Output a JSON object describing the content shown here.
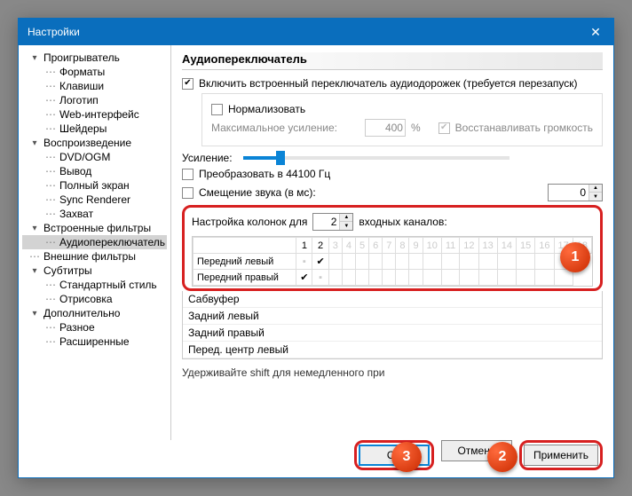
{
  "window": {
    "title": "Настройки"
  },
  "tree": {
    "player": "Проигрыватель",
    "formats": "Форматы",
    "keys": "Клавиши",
    "logo": "Логотип",
    "webui": "Web-интерфейс",
    "shaders": "Шейдеры",
    "playback": "Воспроизведение",
    "dvdogm": "DVD/OGM",
    "output": "Вывод",
    "fullscreen": "Полный экран",
    "syncrender": "Sync Renderer",
    "capture": "Захват",
    "intfilters": "Встроенные фильтры",
    "audioswitch": "Аудиопереключатель",
    "extfilters": "Внешние фильтры",
    "subtitles": "Субтитры",
    "stdstyle": "Стандартный стиль",
    "rendering": "Отрисовка",
    "advanced": "Дополнительно",
    "misc": "Разное",
    "extended": "Расширенные"
  },
  "panel": {
    "title": "Аудиопереключатель",
    "enable": "Включить встроенный переключатель аудиодорожек (требуется перезапуск)",
    "normalize": "Нормализовать",
    "maxgain_label": "Максимальное усиление:",
    "maxgain_value": "400",
    "percent": "%",
    "restore_volume": "Восстанавливать громкость",
    "gain": "Усиление:",
    "convert44": "Преобразовать в 44100 Гц",
    "offset_label": "Смещение звука (в мс):",
    "offset_value": "0",
    "col_label_pre": "Настройка колонок для",
    "col_value": "2",
    "col_label_post": "входных каналов:",
    "hint": "Удерживайте shift для немедленного при"
  },
  "matrix": {
    "cols_active": [
      "1",
      "2"
    ],
    "cols_dim": [
      "3",
      "4",
      "5",
      "6",
      "7",
      "8",
      "9",
      "10",
      "11",
      "12",
      "13",
      "14",
      "15",
      "16",
      "17",
      "18"
    ],
    "rows_visible": [
      {
        "name": "Передний левый",
        "c1": "",
        "c2": "✔"
      },
      {
        "name": "Передний правый",
        "c1": "✔",
        "c2": ""
      }
    ],
    "rows_extra": [
      "Сабвуфер",
      "Задний левый",
      "Задний правый",
      "Перед. центр левый"
    ]
  },
  "buttons": {
    "ok": "ОК",
    "cancel": "Отмена",
    "apply": "Применить"
  },
  "callouts": {
    "c1": "1",
    "c2": "2",
    "c3": "3"
  }
}
